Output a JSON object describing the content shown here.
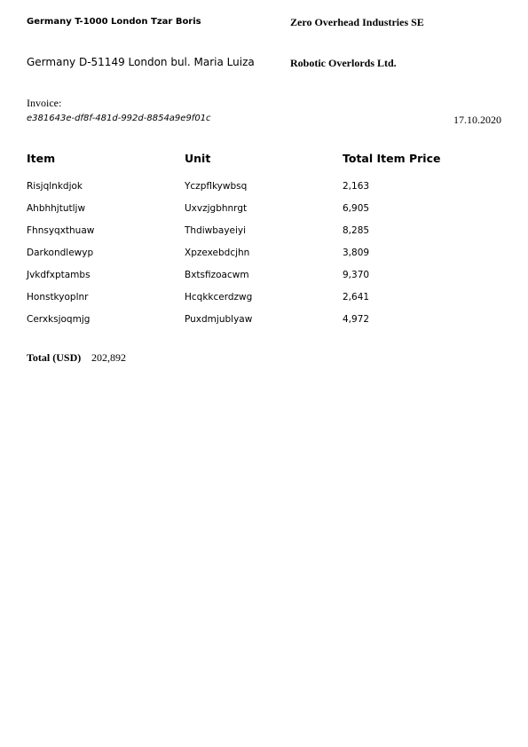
{
  "sender": {
    "line1": "Germany T-1000 London Tzar Boris",
    "line2": "Germany D-51149 London bul. Maria Luiza"
  },
  "recipient": {
    "line1": "Zero Overhead Industries SE",
    "line2": "Robotic Overlords Ltd."
  },
  "invoice": {
    "label": "Invoice:",
    "id": "e381643e-df8f-481d-992d-8854a9e9f01c",
    "date": "17.10.2020"
  },
  "table": {
    "headers": {
      "item": "Item",
      "unit": "Unit",
      "price": "Total Item Price"
    },
    "rows": [
      {
        "item": "Risjqlnkdjok",
        "unit": "Yczpflkywbsq",
        "price": "2,163"
      },
      {
        "item": "Ahbhhjtutljw",
        "unit": "Uxvzjgbhnrgt",
        "price": "6,905"
      },
      {
        "item": "Fhnsyqxthuaw",
        "unit": "Thdiwbayeiyi",
        "price": "8,285"
      },
      {
        "item": "Darkondlewyp",
        "unit": "Xpzexebdcjhn",
        "price": "3,809"
      },
      {
        "item": "Jvkdfxptambs",
        "unit": "Bxtsfizoacwm",
        "price": "9,370"
      },
      {
        "item": "Honstkyoplnr",
        "unit": "Hcqkkcerdzwg",
        "price": "2,641"
      },
      {
        "item": "Cerxksjoqmjg",
        "unit": "Puxdmjublyaw",
        "price": "4,972"
      }
    ]
  },
  "total": {
    "label": "Total (USD)",
    "value": "202,892"
  }
}
